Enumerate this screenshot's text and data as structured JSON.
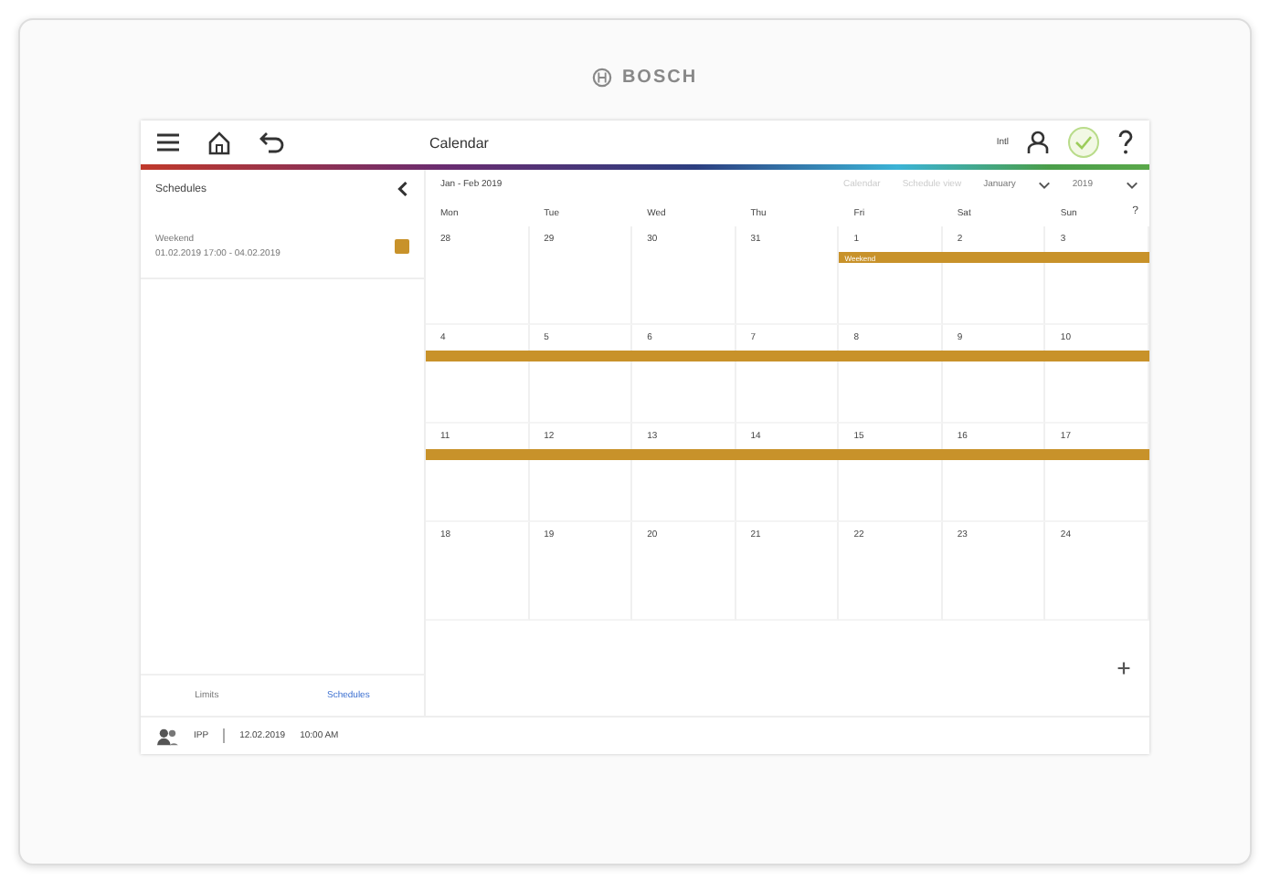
{
  "device": {
    "brand": "BOSCH"
  },
  "header": {
    "title": "Calendar",
    "user_label": "Intl"
  },
  "sidebar": {
    "title": "Schedules",
    "items": [
      {
        "name": "Weekend",
        "range": "01.02.2019 17:00 - 04.02.2019",
        "checked": true,
        "color": "#c8922a"
      }
    ],
    "tabs": [
      {
        "label": "Limits",
        "selected": false
      },
      {
        "label": "Schedules",
        "selected": true
      }
    ]
  },
  "calendar": {
    "range": "Jan - Feb 2019",
    "view_options": [
      {
        "label": "Calendar",
        "selected": false
      },
      {
        "label": "Schedule view",
        "selected": false
      }
    ],
    "month": "January",
    "year": "2019",
    "help": "?",
    "weekdays": [
      "Mon",
      "Tue",
      "Wed",
      "Thu",
      "Fri",
      "Sat",
      "Sun"
    ],
    "weeks": [
      {
        "days": [
          {
            "number": "28",
            "in_event": false
          },
          {
            "number": "29",
            "in_event": false
          },
          {
            "number": "30",
            "in_event": false
          },
          {
            "number": "31",
            "in_event": false
          },
          {
            "number": "1",
            "in_event": true
          },
          {
            "number": "2",
            "in_event": true
          },
          {
            "number": "3",
            "in_event": true
          }
        ],
        "event": {
          "label": "Weekend",
          "color": "#c8922a"
        }
      },
      {
        "days": [
          {
            "number": "4",
            "in_event": true
          },
          {
            "number": "5",
            "in_event": true
          },
          {
            "number": "6",
            "in_event": true
          },
          {
            "number": "7",
            "in_event": true
          },
          {
            "number": "8",
            "in_event": true
          },
          {
            "number": "9",
            "in_event": true
          },
          {
            "number": "10",
            "in_event": true
          }
        ],
        "event": {
          "color": "#c8922a"
        }
      },
      {
        "days": [
          {
            "number": "11",
            "in_event": true
          },
          {
            "number": "12",
            "in_event": true
          },
          {
            "number": "13",
            "in_event": true
          },
          {
            "number": "14",
            "in_event": true
          },
          {
            "number": "15",
            "in_event": true
          },
          {
            "number": "16",
            "in_event": true
          },
          {
            "number": "17",
            "in_event": true
          }
        ],
        "event": {
          "color": "#c8922a"
        }
      },
      {
        "days": [
          {
            "number": "18"
          },
          {
            "number": "19"
          },
          {
            "number": "20"
          },
          {
            "number": "21"
          },
          {
            "number": "22"
          },
          {
            "number": "23"
          },
          {
            "number": "24"
          }
        ]
      }
    ]
  },
  "status_bar": {
    "user": "IPP",
    "date": "12.02.2019",
    "time": "10:00 AM"
  }
}
